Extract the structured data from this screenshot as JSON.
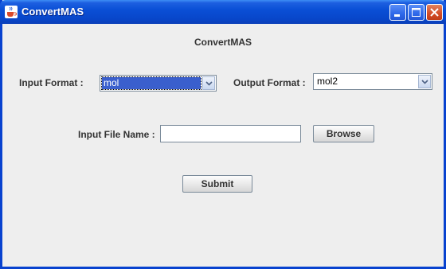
{
  "window": {
    "title": "ConvertMAS",
    "icon": "java-cup-icon",
    "controls": [
      "minimize-icon",
      "maximize-icon",
      "close-icon"
    ]
  },
  "form": {
    "heading": "ConvertMAS",
    "input_format_label": "Input Format :",
    "input_format_value": "mol",
    "output_format_label": "Output Format :",
    "output_format_value": "mol2",
    "input_file_label": "Input File Name :",
    "input_file_value": "",
    "browse_label": "Browse",
    "submit_label": "Submit"
  },
  "colors": {
    "titlebar": "#0a4fd6",
    "selection": "#3a5fcd",
    "panel": "#eeeeee"
  }
}
